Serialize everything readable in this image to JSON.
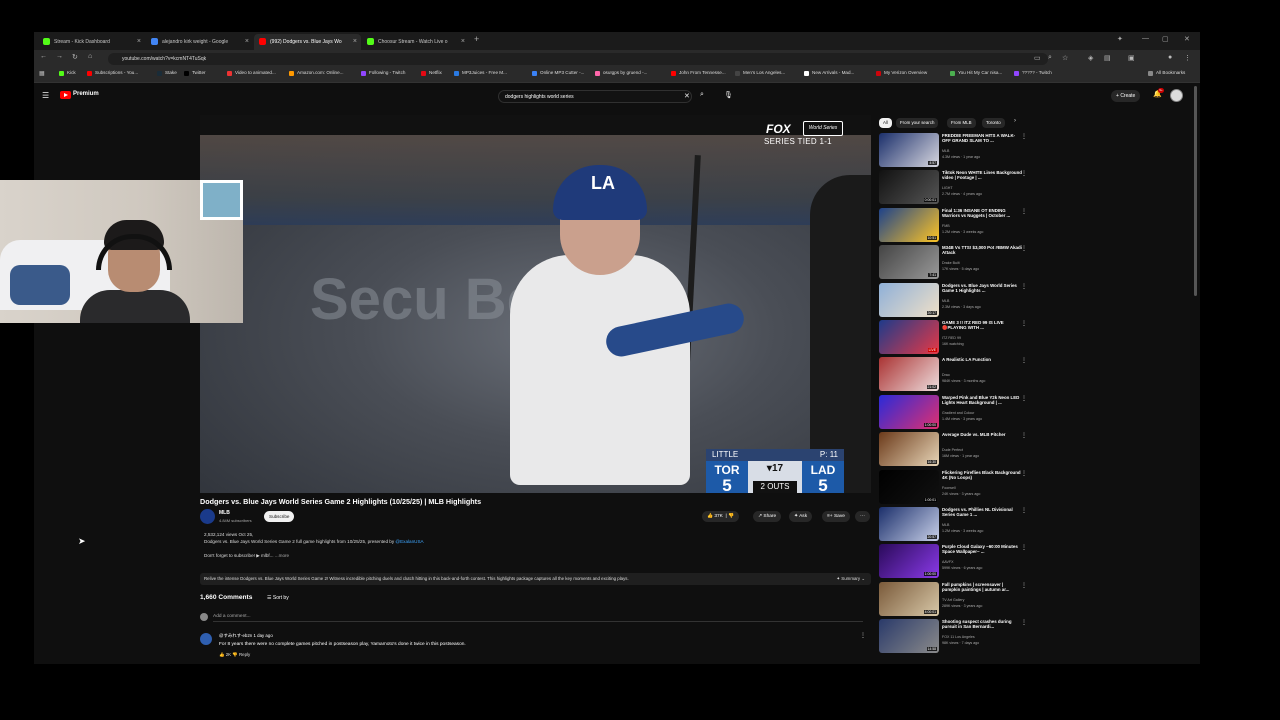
{
  "browser": {
    "tabs": [
      {
        "label": "Stream - Kick Dashboard",
        "color": "#53fc18"
      },
      {
        "label": "alejandro kirk weight - Google",
        "color": "#4285f4"
      },
      {
        "label": "(992) Dodgers vs. Blue Jays Wo",
        "color": "#ff0000"
      },
      {
        "label": "Choosur Stream - Watch Live o",
        "color": "#53fc18"
      }
    ],
    "url": "youtube.com/watch?v=kcmNT4TuSqk",
    "bookmarks": [
      {
        "label": "Kick",
        "color": "#53fc18"
      },
      {
        "label": "Subscriptions - You...",
        "color": "#ff0000"
      },
      {
        "label": "Stake",
        "color": "#1a2c38"
      },
      {
        "label": "Twitter",
        "color": "#000000"
      },
      {
        "label": "Video to animated...",
        "color": "#e33"
      },
      {
        "label": "Amazon.com: Online...",
        "color": "#ff9900"
      },
      {
        "label": "Following - Twitch",
        "color": "#9146ff"
      },
      {
        "label": "Netflix",
        "color": "#e50914"
      },
      {
        "label": "MP3Juices - Free M...",
        "color": "#2a7ae2"
      },
      {
        "label": "Online MP3 Cutter -...",
        "color": "#3b82f6"
      },
      {
        "label": "osu!gps by gruend -...",
        "color": "#ff66aa"
      },
      {
        "label": "John From Tennesse...",
        "color": "#ff0000"
      },
      {
        "label": "Men's Los Angeles...",
        "color": "#444"
      },
      {
        "label": "New Arrivals - Mad...",
        "color": "#fff"
      },
      {
        "label": "My Verizon Overview",
        "color": "#cd040b"
      },
      {
        "label": "You Hit My Car nisa...",
        "color": "#4caf50"
      },
      {
        "label": "????? - Twitch",
        "color": "#9146ff"
      }
    ],
    "all_bookmarks": "All Bookmarks"
  },
  "youtube": {
    "brand": "Premium",
    "search_query": "dodgers highlights world series",
    "create_label": "Create",
    "notif_count": "9+"
  },
  "video": {
    "fox": "FOX",
    "world_series": "World Series",
    "series_status": "SERIES TIED 1-1",
    "wall_text": "Secu Bene",
    "scorebug": {
      "batter": "LITTLE",
      "pitch_count": "P: 11",
      "away_team": "TOR",
      "away_score": "5",
      "home_team": "LAD",
      "home_score": "5",
      "inning": "▾17",
      "outs": "2 OUTS"
    },
    "title": "Dodgers vs. Blue Jays World Series Game 2 Highlights (10/25/25) | MLB Highlights",
    "channel": "MLB",
    "subscribers": "4.84M subscribers",
    "subscribe_label": "Subscribe",
    "likes": "37K",
    "share_label": "Share",
    "ask_label": "Ask",
    "save_label": "Save",
    "desc_line1": "2,532,124 views  Oct 25,",
    "desc_line2": "Dodgers vs. Blue Jays World Series Game 2 full game highlights from 10/25/25, presented by",
    "desc_sponsor": "@ExalanUSA",
    "desc_line3": "Don't forget to subscribe! ▶ mlbf... ",
    "desc_more": "...more",
    "summary_text": "Relive the intense Dodgers vs. Blue Jays World Series Game 2! Witness incredible pitching duels and clutch hitting in this back-and-forth contest. This highlights package captures all the key moments and exciting plays.",
    "summary_btn": "Summary"
  },
  "comments": {
    "count": "1,660 Comments",
    "sort_label": "Sort by",
    "add_placeholder": "Add a comment...",
    "first": {
      "author": "@すみれす-eb2n  1 day ago",
      "text": "For 8 years there were no complete games pitched in postseason play, Yamamoto's done it twice in this postseason.",
      "likes": "2K",
      "reply": "Reply"
    }
  },
  "sidebar": {
    "chips": [
      "All",
      "From your search",
      "From MLB",
      "Toronto"
    ],
    "videos": [
      {
        "title": "FREDDIE FREEMAN HITS A WALK-OFF GRAND SLAM TO ...",
        "channel": "MLB",
        "views": "4.3M views · 1 year ago",
        "dur": "4:57",
        "c1": "#1b2f6b",
        "c2": "#d8d8e0"
      },
      {
        "title": "Tiktok Neon WHITE Lines Background video | Footage | ...",
        "channel": "LIGHT",
        "views": "2.7M views · 4 years ago",
        "dur": "0:00:01",
        "c1": "#111",
        "c2": "#555"
      },
      {
        "title": "Final 1:36 INSANE OT ENDING Warriors vs Nuggets | October ...",
        "channel": "FMB",
        "views": "1.2M views · 3 weeks ago",
        "dur": "10:51",
        "c1": "#1d428a",
        "c2": "#fec524"
      },
      {
        "title": "M34B Vs TTS! $3,000 Pot #BMW Akadi Attack",
        "channel": "Drake Built",
        "views": "17K views · 5 days ago",
        "dur": "7:41",
        "c1": "#444",
        "c2": "#999"
      },
      {
        "title": "Dodgers vs. Blue Jays World Series Game 1 Highlights ...",
        "channel": "MLB",
        "views": "2.3M views · 3 days ago",
        "dur": "20:17",
        "c1": "#8fb0d8",
        "c2": "#efe0c8"
      },
      {
        "title": "GAME 3 !! ITZ RED 99 IS LIVE 🔴PLAYING WITH ...",
        "channel": "ITZ RED 99",
        "views": "16K watching",
        "dur": "LIVE",
        "c1": "#1e3a8a",
        "c2": "#e63946"
      },
      {
        "title": "A Realistic LA Function",
        "channel": "Drao",
        "views": "984K views · 3 months ago",
        "dur": "21:02",
        "c1": "#a33",
        "c2": "#edd"
      },
      {
        "title": "Warped Pink and Blue Y2k Neon LED Lights Heart Background | ...",
        "channel": "Gradient and Colour",
        "views": "1.4M views · 3 years ago",
        "dur": "1:00:00",
        "c1": "#2a2ad8",
        "c2": "#e03070"
      },
      {
        "title": "Average Dude vs. MLB Pitcher",
        "channel": "Dude Perfect",
        "views": "16M views · 1 year ago",
        "dur": "16:30",
        "c1": "#6b3a1a",
        "c2": "#e8d6b8"
      },
      {
        "title": "Flickering Fireflies Black Background 4K (No Loops)",
        "channel": "Foorwell",
        "views": "24K views · 3 years ago",
        "dur": "1:00:01",
        "c1": "#000",
        "c2": "#111"
      },
      {
        "title": "Dodgers vs. Phillies NL Divisional Series Game 1 ...",
        "channel": "MLB",
        "views": "1.2M views · 3 weeks ago",
        "dur": "20:57",
        "c1": "#1b2f6b",
        "c2": "#c8d0e8"
      },
      {
        "title": "Purple Cloud Galaxy ~60:00 Minutes Space Wallpaper~ ...",
        "channel": "AAVFX",
        "views": "599K views · 6 years ago",
        "dur": "1:00:00",
        "c1": "#2a0a5a",
        "c2": "#8a3ae8"
      },
      {
        "title": "Fall pumpkins | screensaver | pumpkin paintings | autumn ar...",
        "channel": "TV Art Gallery",
        "views": "289K views · 3 years ago",
        "dur": "4:00:01",
        "c1": "#7a5a3a",
        "c2": "#d8c8a8"
      },
      {
        "title": "Shooting suspect crashes during pursuit in San Bernardi...",
        "channel": "FOX 11 Los Angeles",
        "views": "98K views · 7 days ago",
        "dur": "14:58",
        "c1": "#2a3a6a",
        "c2": "#8a8a8a"
      }
    ]
  }
}
